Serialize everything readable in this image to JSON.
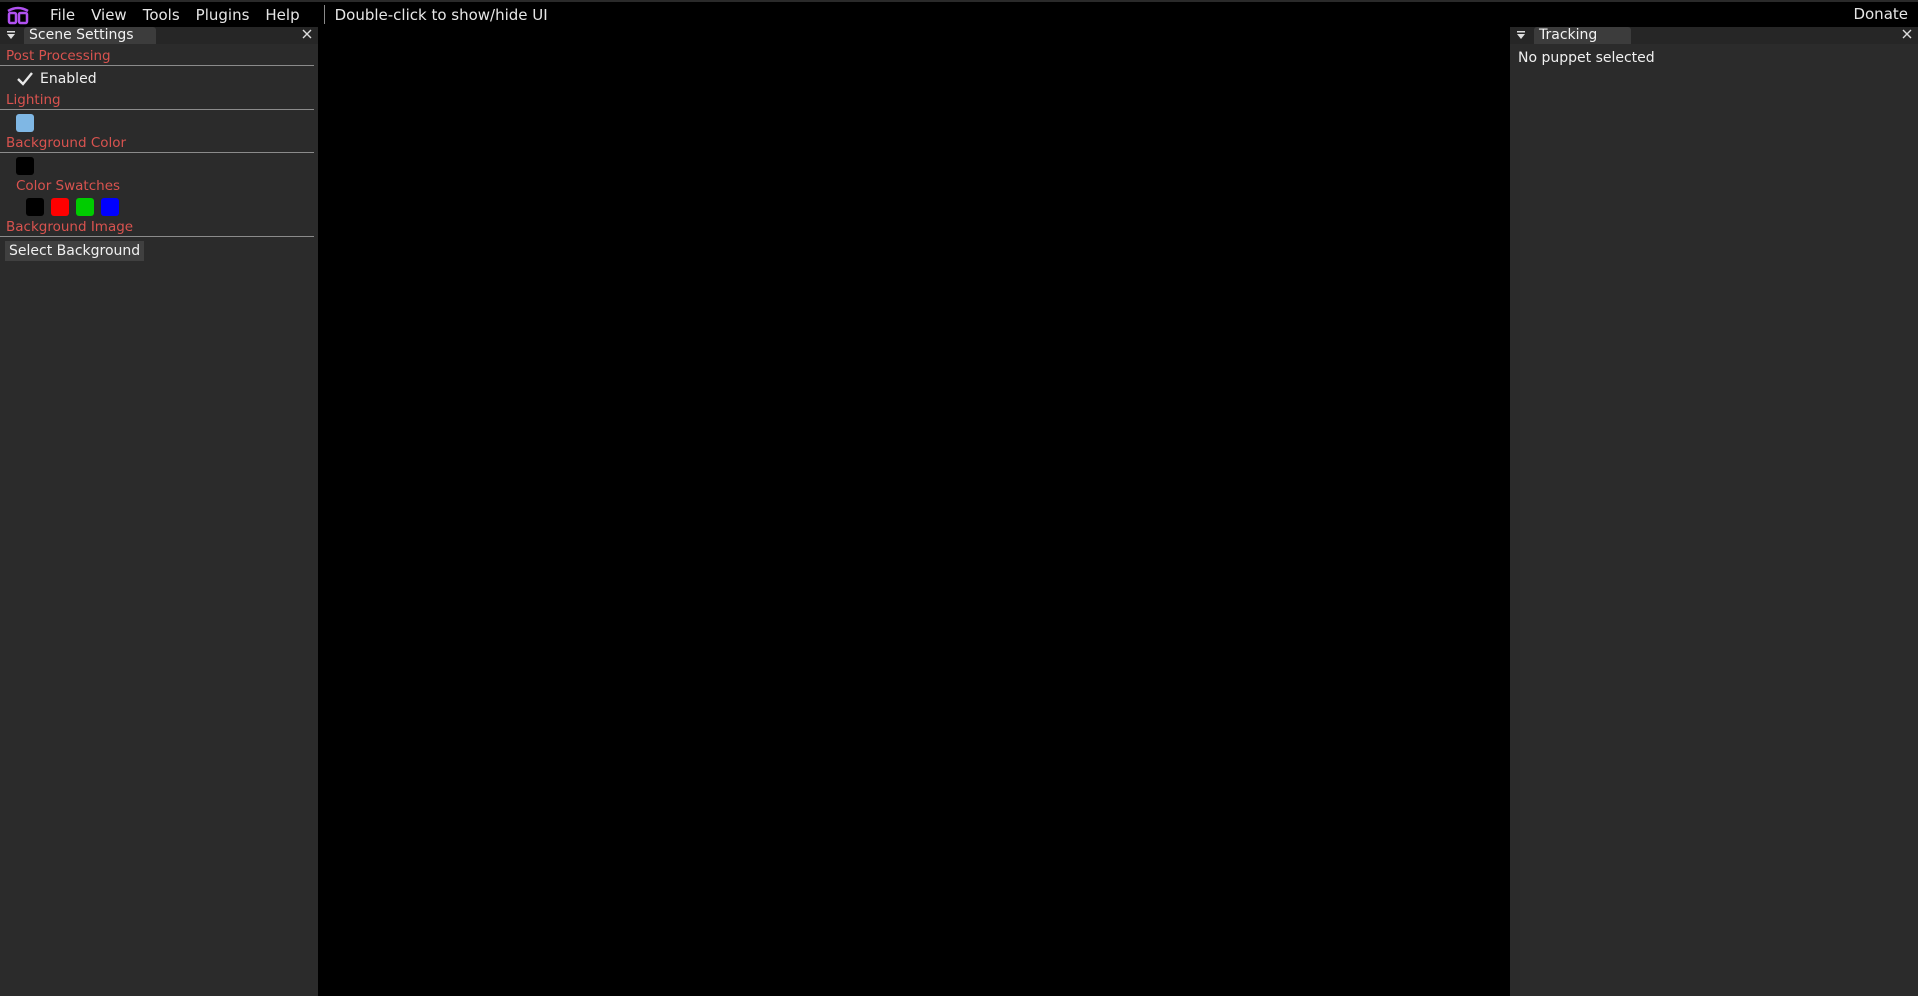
{
  "menubar": {
    "items": [
      "File",
      "View",
      "Tools",
      "Plugins",
      "Help"
    ],
    "hint": "Double-click to show/hide UI",
    "donate": "Donate"
  },
  "left_panel": {
    "title": "Scene Settings",
    "sections": {
      "post_processing": "Post Processing",
      "enabled_label": "Enabled",
      "enabled_checked": true,
      "lighting": "Lighting",
      "lighting_color": "#7fb7e4",
      "background_color": "Background Color",
      "background_color_value": "#000000",
      "color_swatches": "Color Swatches",
      "swatches": [
        "#000000",
        "#ff0000",
        "#00cc00",
        "#0000ff"
      ],
      "background_image": "Background Image",
      "select_background": "Select Background"
    }
  },
  "right_panel": {
    "title": "Tracking",
    "status": "No puppet selected"
  },
  "colors": {
    "section_header": "#d9534f",
    "panel_bg": "#2b2b2b",
    "viewport_bg": "#000000"
  }
}
